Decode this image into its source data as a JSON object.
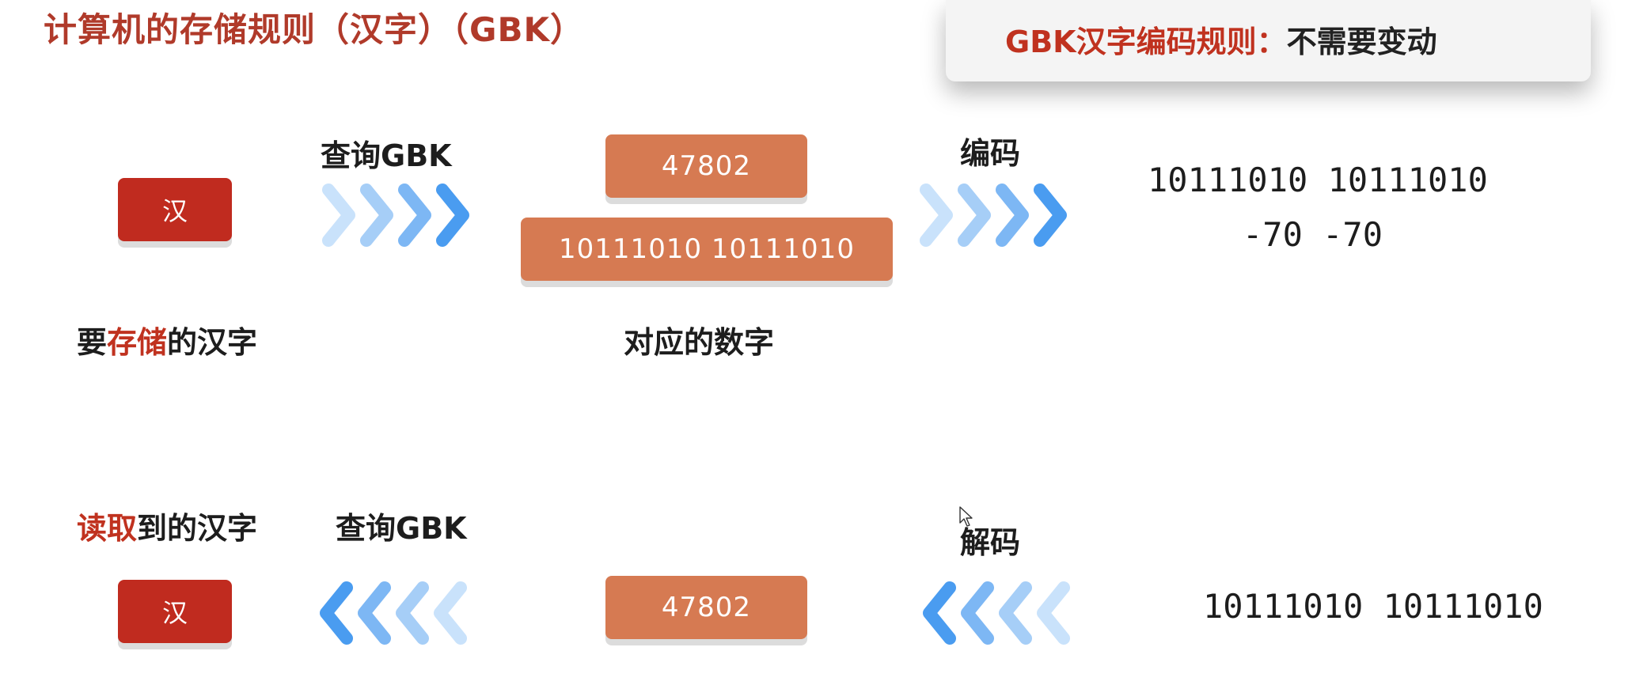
{
  "title": "计算机的存储规则（汉字）（GBK）",
  "note": {
    "strong": "GBK汉字编码规则：",
    "normal": "不需要变动"
  },
  "encode_row": {
    "char": "汉",
    "lookup_label": "查询GBK",
    "decimal": "47802",
    "binary_box": "10111010 10111010",
    "encode_label": "编码",
    "bits_line": "10111010  10111010",
    "signed_line": "-70 -70",
    "caption_left_pre": "要",
    "caption_left_red": "存储",
    "caption_left_post": "的汉字",
    "caption_mid": "对应的数字"
  },
  "decode_row": {
    "caption_left_red": "读取",
    "caption_left_post": "到的汉字",
    "lookup_label": "查询GBK",
    "decode_label": "解码",
    "char": "汉",
    "decimal": "47802",
    "bits_line": "10111010  10111010"
  },
  "icons": {
    "arrows_right": "chevron-right-icon",
    "arrows_left": "chevron-left-icon",
    "cursor": "mouse-cursor-icon"
  },
  "colors": {
    "title": "#b03a2a",
    "char_box": "#c02b1f",
    "number_box": "#d67a52",
    "chevron_dark": "#4a9cf0",
    "chevron_light": "#c9e2fb"
  }
}
